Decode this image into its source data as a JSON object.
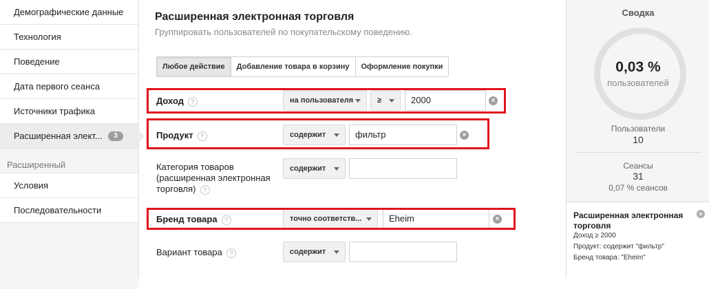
{
  "sidebar": {
    "items": [
      {
        "label": "Демографические данные"
      },
      {
        "label": "Технология"
      },
      {
        "label": "Поведение"
      },
      {
        "label": "Дата первого сеанса"
      },
      {
        "label": "Источники трафика"
      },
      {
        "label": "Расширенная элект...",
        "badge": "3",
        "active": true
      }
    ],
    "section_label": "Расширенный",
    "advanced_items": [
      {
        "label": "Условия"
      },
      {
        "label": "Последовательности"
      }
    ]
  },
  "main": {
    "title": "Расширенная электронная торговля",
    "subtitle": "Группировать пользователей по покупательскому поведению.",
    "tabs": [
      {
        "label": "Любое действие",
        "active": true
      },
      {
        "label": "Добавление товара в корзину"
      },
      {
        "label": "Оформление покупки"
      }
    ],
    "filters": {
      "revenue": {
        "label": "Доход",
        "scope": "на пользователя",
        "operator": "≥",
        "value": "2000"
      },
      "product": {
        "label": "Продукт",
        "operator": "содержит",
        "value": "фильтр"
      },
      "category": {
        "label_lines": [
          "Категория товаров",
          "(расширенная электронная",
          "торговля)"
        ],
        "operator": "содержит",
        "value": ""
      },
      "brand": {
        "label": "Бренд товара",
        "operator": "точно соответств...",
        "value": "Eheim"
      },
      "variant": {
        "label": "Вариант товара",
        "operator": "содержит",
        "value": ""
      }
    },
    "help_glyph": "?",
    "clear_glyph": "×"
  },
  "summary": {
    "title": "Сводка",
    "percent": "0,03 %",
    "percent_label": "пользователей",
    "users_label": "Пользователи",
    "users_value": "10",
    "sessions_label": "Сеансы",
    "sessions_value": "31",
    "sessions_share": "0,07 % сеансов",
    "segment": {
      "title": "Расширенная электронная торговля",
      "lines": [
        "Доход ≥ 2000",
        "Продукт: содержит \"фильтр\"",
        "Бренд товара: \"Eheim\""
      ]
    }
  },
  "colors": {
    "highlight": "#e0141e",
    "sidebar_bg": "#f5f5f5",
    "badge": "#9e9e9e"
  },
  "icons": [
    "help-icon",
    "clear-icon",
    "chevron-down-icon",
    "close-icon"
  ]
}
